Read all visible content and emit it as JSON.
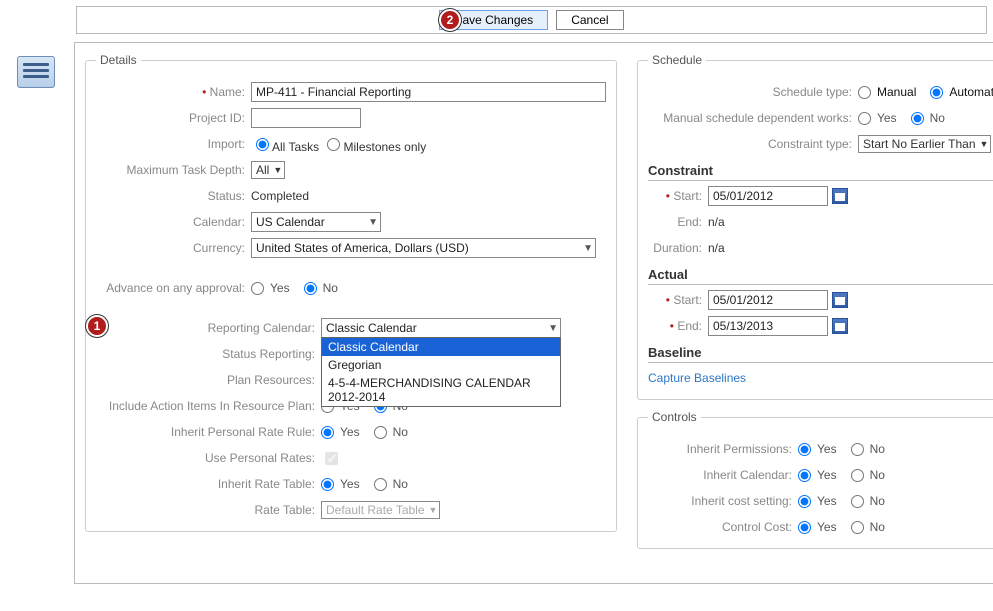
{
  "toolbar": {
    "save": "Save Changes",
    "cancel": "Cancel",
    "badge": "2"
  },
  "details": {
    "legend": "Details",
    "labels": {
      "name": "Name:",
      "project_id": "Project ID:",
      "import": "Import:",
      "max_task_depth": "Maximum Task Depth:",
      "status": "Status:",
      "calendar": "Calendar:",
      "currency": "Currency:",
      "advance": "Advance on any approval:",
      "reporting_calendar": "Reporting Calendar:",
      "status_reporting": "Status Reporting:",
      "plan_resources": "Plan Resources:",
      "include_action_items": "Include Action Items In Resource Plan:",
      "inherit_personal_rate": "Inherit Personal Rate Rule:",
      "use_personal_rates": "Use Personal Rates:",
      "inherit_rate_table": "Inherit Rate Table:",
      "rate_table": "Rate Table:"
    },
    "name": "MP-411 - Financial Reporting",
    "project_id": "",
    "import": {
      "all_tasks": "All Tasks",
      "milestones_only": "Milestones only"
    },
    "max_task_depth": "All",
    "status": "Completed",
    "calendar": "US Calendar",
    "currency": "United States of America, Dollars (USD)",
    "yes": "Yes",
    "no": "No",
    "reporting_calendar": {
      "current": "Classic Calendar",
      "options": [
        "Classic Calendar",
        "Gregorian",
        "4-5-4-MERCHANDISING CALENDAR 2012-2014"
      ]
    },
    "badge_reporting": "1",
    "rate_table_value": "Default Rate Table"
  },
  "schedule": {
    "legend": "Schedule",
    "labels": {
      "schedule_type": "Schedule type:",
      "manual_dep": "Manual schedule dependent works:",
      "constraint_type": "Constraint type:",
      "start": "Start:",
      "end": "End:",
      "duration": "Duration:"
    },
    "manual": "Manual",
    "automatic": "Automatic",
    "yes": "Yes",
    "no": "No",
    "constraint_type": "Start No Earlier Than",
    "constraint": "Constraint",
    "constraint_start": "05/01/2012",
    "na": "n/a",
    "actual": "Actual",
    "actual_start": "05/01/2012",
    "actual_end": "05/13/2013",
    "baseline": "Baseline",
    "capture_baselines": "Capture Baselines"
  },
  "controls": {
    "legend": "Controls",
    "labels": {
      "inherit_permissions": "Inherit Permissions:",
      "inherit_calendar": "Inherit Calendar:",
      "inherit_cost": "Inherit cost setting:",
      "control_cost": "Control Cost:"
    },
    "yes": "Yes",
    "no": "No"
  }
}
